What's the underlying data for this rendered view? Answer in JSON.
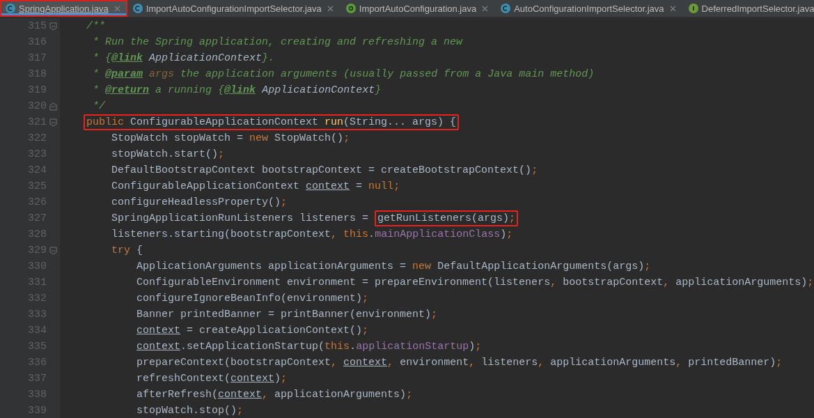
{
  "tabs": [
    {
      "label": "SpringApplication.java",
      "kind": "class",
      "selected": true
    },
    {
      "label": "ImportAutoConfigurationImportSelector.java",
      "kind": "class",
      "selected": false
    },
    {
      "label": "ImportAutoConfiguration.java",
      "kind": "annotation",
      "selected": false
    },
    {
      "label": "AutoConfigurationImportSelector.java",
      "kind": "class",
      "selected": false
    },
    {
      "label": "DeferredImportSelector.java",
      "kind": "interface",
      "selected": false
    }
  ],
  "lines": [
    {
      "number": "315",
      "kind": "foldstart",
      "segments": [
        {
          "boxed": false,
          "tokens": [
            {
              "text": "    /**",
              "kind": "comment"
            }
          ]
        }
      ]
    },
    {
      "number": "316",
      "kind": "plain",
      "segments": [
        {
          "boxed": false,
          "tokens": [
            {
              "text": "     * Run the Spring application, creating and refreshing a new",
              "kind": "comment"
            }
          ]
        }
      ]
    },
    {
      "number": "317",
      "kind": "plain",
      "segments": [
        {
          "boxed": false,
          "tokens": [
            {
              "text": "     * {",
              "kind": "comment"
            },
            {
              "text": "@link",
              "kind": "doctag"
            },
            {
              "text": " ApplicationContext",
              "kind": "docref"
            },
            {
              "text": "}.",
              "kind": "comment"
            }
          ]
        }
      ]
    },
    {
      "number": "318",
      "kind": "plain",
      "segments": [
        {
          "boxed": false,
          "tokens": [
            {
              "text": "     * ",
              "kind": "comment"
            },
            {
              "text": "@param",
              "kind": "doctag"
            },
            {
              "text": " args",
              "kind": "docparam"
            },
            {
              "text": " the application arguments (usually passed from a Java main method)",
              "kind": "comment"
            }
          ]
        }
      ]
    },
    {
      "number": "319",
      "kind": "plain",
      "segments": [
        {
          "boxed": false,
          "tokens": [
            {
              "text": "     * ",
              "kind": "comment"
            },
            {
              "text": "@return",
              "kind": "doctag"
            },
            {
              "text": " a running {",
              "kind": "comment"
            },
            {
              "text": "@link",
              "kind": "doctag"
            },
            {
              "text": " ApplicationContext",
              "kind": "docref"
            },
            {
              "text": "}",
              "kind": "comment"
            }
          ]
        }
      ]
    },
    {
      "number": "320",
      "kind": "foldend",
      "segments": [
        {
          "boxed": false,
          "tokens": [
            {
              "text": "     */",
              "kind": "comment"
            }
          ]
        }
      ]
    },
    {
      "number": "321",
      "kind": "foldstart",
      "segments": [
        {
          "boxed": true,
          "tokens": [
            {
              "text": "public",
              "kind": "keyword"
            },
            {
              "text": " ConfigurableApplicationContext ",
              "kind": "plain"
            },
            {
              "text": "run",
              "kind": "method"
            },
            {
              "text": "(String... args) {",
              "kind": "plain"
            }
          ]
        }
      ]
    },
    {
      "number": "322",
      "kind": "plain",
      "segments": [
        {
          "boxed": false,
          "tokens": [
            {
              "text": "        StopWatch stopWatch = ",
              "kind": "plain"
            },
            {
              "text": "new",
              "kind": "keyword"
            },
            {
              "text": " StopWatch()",
              "kind": "plain"
            },
            {
              "text": ";",
              "kind": "punct"
            }
          ]
        }
      ]
    },
    {
      "number": "323",
      "kind": "plain",
      "segments": [
        {
          "boxed": false,
          "tokens": [
            {
              "text": "        stopWatch.start()",
              "kind": "plain"
            },
            {
              "text": ";",
              "kind": "punct"
            }
          ]
        }
      ]
    },
    {
      "number": "324",
      "kind": "plain",
      "segments": [
        {
          "boxed": false,
          "tokens": [
            {
              "text": "        DefaultBootstrapContext bootstrapContext = createBootstrapContext()",
              "kind": "plain"
            },
            {
              "text": ";",
              "kind": "punct"
            }
          ]
        }
      ]
    },
    {
      "number": "325",
      "kind": "plain",
      "segments": [
        {
          "boxed": false,
          "tokens": [
            {
              "text": "        ConfigurableApplicationContext ",
              "kind": "plain"
            },
            {
              "text": "context",
              "kind": "local"
            },
            {
              "text": " = ",
              "kind": "plain"
            },
            {
              "text": "null",
              "kind": "keyword"
            },
            {
              "text": ";",
              "kind": "punct"
            }
          ]
        }
      ]
    },
    {
      "number": "326",
      "kind": "plain",
      "segments": [
        {
          "boxed": false,
          "tokens": [
            {
              "text": "        configureHeadlessProperty()",
              "kind": "plain"
            },
            {
              "text": ";",
              "kind": "punct"
            }
          ]
        }
      ]
    },
    {
      "number": "327",
      "kind": "plain",
      "segments": [
        {
          "boxed": false,
          "tokens": [
            {
              "text": "        SpringApplicationRunListeners listeners = ",
              "kind": "plain"
            }
          ]
        },
        {
          "boxed": true,
          "tokens": [
            {
              "text": "getRunListeners(args)",
              "kind": "plain"
            },
            {
              "text": ";",
              "kind": "punct"
            }
          ]
        }
      ]
    },
    {
      "number": "328",
      "kind": "plain",
      "segments": [
        {
          "boxed": false,
          "tokens": [
            {
              "text": "        listeners.starting(bootstrapContext",
              "kind": "plain"
            },
            {
              "text": ", ",
              "kind": "punct"
            },
            {
              "text": "this",
              "kind": "keyword"
            },
            {
              "text": ".",
              "kind": "plain"
            },
            {
              "text": "mainApplicationClass",
              "kind": "field"
            },
            {
              "text": ")",
              "kind": "plain"
            },
            {
              "text": ";",
              "kind": "punct"
            }
          ]
        }
      ]
    },
    {
      "number": "329",
      "kind": "foldstart",
      "segments": [
        {
          "boxed": false,
          "tokens": [
            {
              "text": "        try",
              "kind": "keyword"
            },
            {
              "text": " {",
              "kind": "plain"
            }
          ]
        }
      ]
    },
    {
      "number": "330",
      "kind": "plain",
      "segments": [
        {
          "boxed": false,
          "tokens": [
            {
              "text": "            ApplicationArguments applicationArguments = ",
              "kind": "plain"
            },
            {
              "text": "new",
              "kind": "keyword"
            },
            {
              "text": " DefaultApplicationArguments(args)",
              "kind": "plain"
            },
            {
              "text": ";",
              "kind": "punct"
            }
          ]
        }
      ]
    },
    {
      "number": "331",
      "kind": "plain",
      "segments": [
        {
          "boxed": false,
          "tokens": [
            {
              "text": "            ConfigurableEnvironment environment = prepareEnvironment(listeners",
              "kind": "plain"
            },
            {
              "text": ", ",
              "kind": "punct"
            },
            {
              "text": "bootstrapContext",
              "kind": "plain"
            },
            {
              "text": ", ",
              "kind": "punct"
            },
            {
              "text": "applicationArguments)",
              "kind": "plain"
            },
            {
              "text": ";",
              "kind": "punct"
            }
          ]
        }
      ]
    },
    {
      "number": "332",
      "kind": "plain",
      "segments": [
        {
          "boxed": false,
          "tokens": [
            {
              "text": "            configureIgnoreBeanInfo(environment)",
              "kind": "plain"
            },
            {
              "text": ";",
              "kind": "punct"
            }
          ]
        }
      ]
    },
    {
      "number": "333",
      "kind": "plain",
      "segments": [
        {
          "boxed": false,
          "tokens": [
            {
              "text": "            Banner printedBanner = printBanner(environment)",
              "kind": "plain"
            },
            {
              "text": ";",
              "kind": "punct"
            }
          ]
        }
      ]
    },
    {
      "number": "334",
      "kind": "plain",
      "segments": [
        {
          "boxed": false,
          "tokens": [
            {
              "text": "            context",
              "kind": "local"
            },
            {
              "text": " = createApplicationContext()",
              "kind": "plain"
            },
            {
              "text": ";",
              "kind": "punct"
            }
          ]
        }
      ]
    },
    {
      "number": "335",
      "kind": "plain",
      "segments": [
        {
          "boxed": false,
          "tokens": [
            {
              "text": "            context",
              "kind": "local"
            },
            {
              "text": ".setApplicationStartup(",
              "kind": "plain"
            },
            {
              "text": "this",
              "kind": "keyword"
            },
            {
              "text": ".",
              "kind": "plain"
            },
            {
              "text": "applicationStartup",
              "kind": "field"
            },
            {
              "text": ")",
              "kind": "plain"
            },
            {
              "text": ";",
              "kind": "punct"
            }
          ]
        }
      ]
    },
    {
      "number": "336",
      "kind": "plain",
      "segments": [
        {
          "boxed": false,
          "tokens": [
            {
              "text": "            prepareContext(bootstrapContext",
              "kind": "plain"
            },
            {
              "text": ", ",
              "kind": "punct"
            },
            {
              "text": "context",
              "kind": "local"
            },
            {
              "text": ", ",
              "kind": "punct"
            },
            {
              "text": "environment",
              "kind": "plain"
            },
            {
              "text": ", ",
              "kind": "punct"
            },
            {
              "text": "listeners",
              "kind": "plain"
            },
            {
              "text": ", ",
              "kind": "punct"
            },
            {
              "text": "applicationArguments",
              "kind": "plain"
            },
            {
              "text": ", ",
              "kind": "punct"
            },
            {
              "text": "printedBanner)",
              "kind": "plain"
            },
            {
              "text": ";",
              "kind": "punct"
            }
          ]
        }
      ]
    },
    {
      "number": "337",
      "kind": "plain",
      "segments": [
        {
          "boxed": false,
          "tokens": [
            {
              "text": "            refreshContext(",
              "kind": "plain"
            },
            {
              "text": "context",
              "kind": "local"
            },
            {
              "text": ")",
              "kind": "plain"
            },
            {
              "text": ";",
              "kind": "punct"
            }
          ]
        }
      ]
    },
    {
      "number": "338",
      "kind": "plain",
      "segments": [
        {
          "boxed": false,
          "tokens": [
            {
              "text": "            afterRefresh(",
              "kind": "plain"
            },
            {
              "text": "context",
              "kind": "local"
            },
            {
              "text": ", ",
              "kind": "punct"
            },
            {
              "text": "applicationArguments)",
              "kind": "plain"
            },
            {
              "text": ";",
              "kind": "punct"
            }
          ]
        }
      ]
    },
    {
      "number": "339",
      "kind": "plain",
      "segments": [
        {
          "boxed": false,
          "tokens": [
            {
              "text": "            stopWatch.stop()",
              "kind": "plain"
            },
            {
              "text": ";",
              "kind": "punct"
            }
          ]
        }
      ]
    }
  ]
}
